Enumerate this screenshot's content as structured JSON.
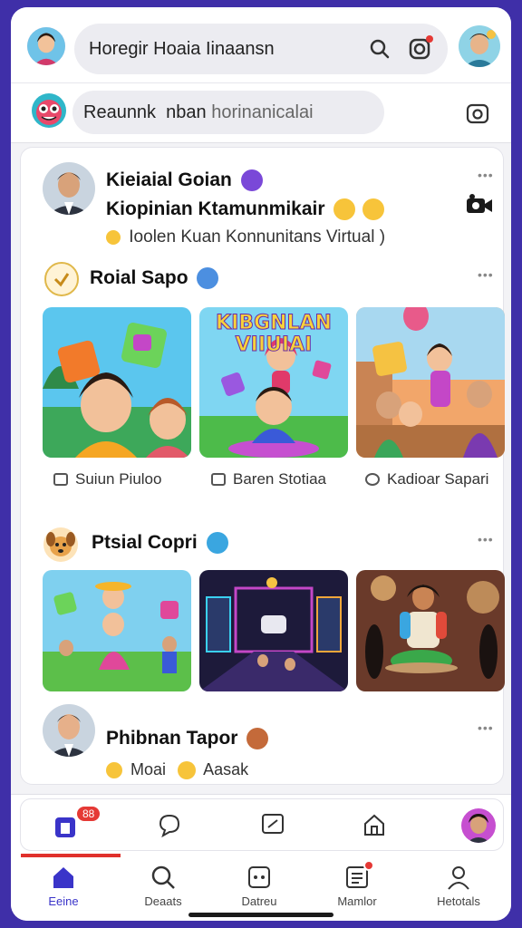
{
  "header": {
    "search_text": "Horegir Hoaia Iinaansn",
    "search_icon": "search-icon",
    "camera_icon": "camera-icon"
  },
  "status": {
    "prompt_main": "Reaunnk  nban ",
    "prompt_faded": "horinanicalai",
    "camera_icon": "camera-outline-icon"
  },
  "post": {
    "name": "Kieiaial Goian",
    "subtitle": "Kiopinian Ktamunmikair",
    "location": "Ioolen Kuan Konnunitans Virtual )",
    "more": "•••"
  },
  "section1": {
    "title": "Roial Sapo",
    "more": "•••",
    "banner_text": [
      "KIBGNLAN",
      "VIIUIAI"
    ],
    "items": [
      {
        "caption": "Suiun Piuloo"
      },
      {
        "caption": "Baren Stotiaa"
      },
      {
        "caption": "Kadioar Sapari"
      }
    ]
  },
  "section2": {
    "title": "Ptsial Copri",
    "more": "•••"
  },
  "section3": {
    "title": "Phibnan Tapor",
    "reactions": "Moai",
    "reactions2": "Aasak",
    "more": "•••"
  },
  "mini_tabs": {
    "badge": "88"
  },
  "nav": {
    "items": [
      {
        "label": "Eeine",
        "icon": "home-icon"
      },
      {
        "label": "Deaats",
        "icon": "search-icon"
      },
      {
        "label": "Datreu",
        "icon": "game-icon"
      },
      {
        "label": "Mamlor",
        "icon": "news-icon"
      },
      {
        "label": "Hetotals",
        "icon": "profile-icon"
      }
    ]
  },
  "colors": {
    "frame": "#3f2fa8",
    "accent": "#3a34c9",
    "badge": "#e53935"
  }
}
